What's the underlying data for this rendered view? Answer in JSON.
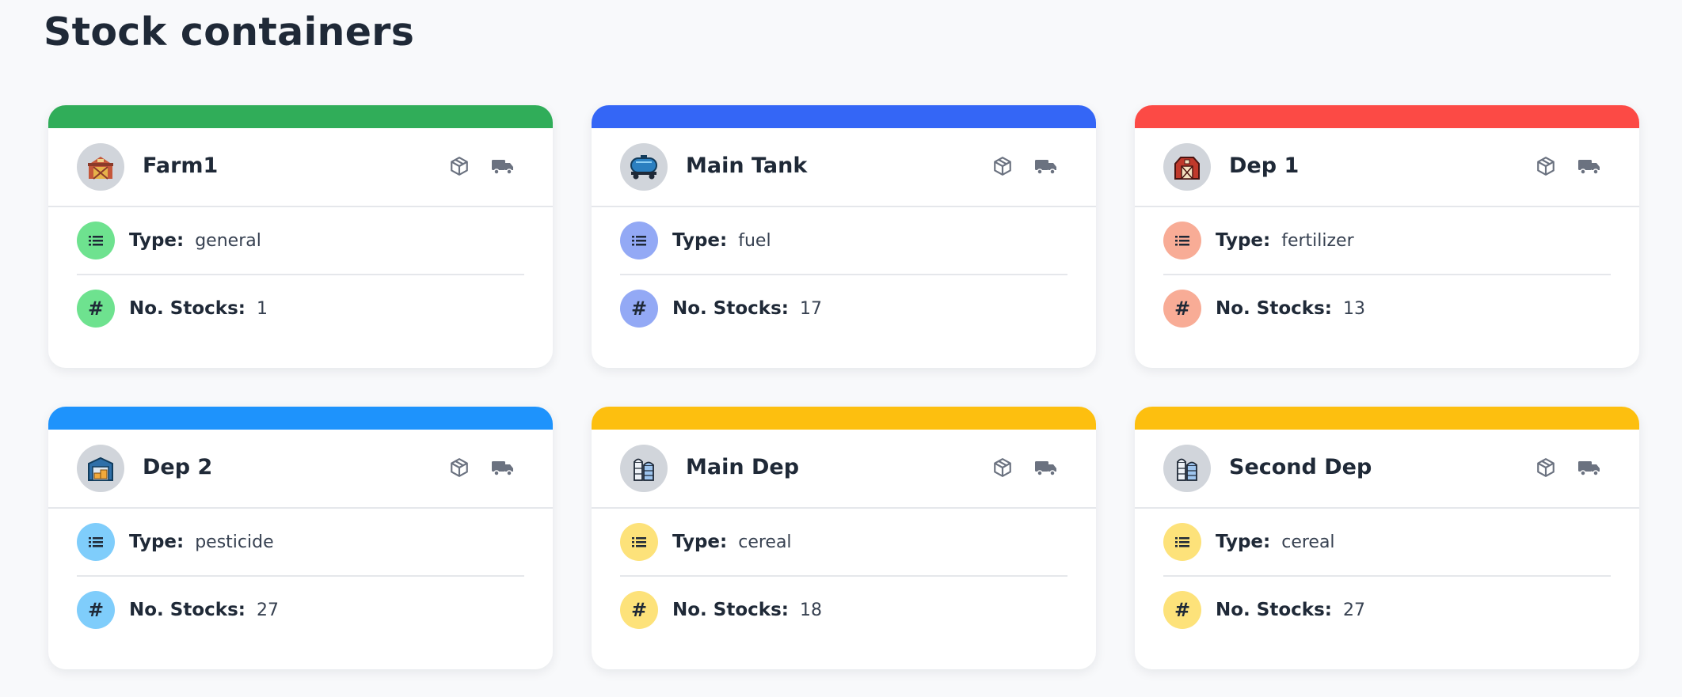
{
  "page": {
    "title": "Stock containers"
  },
  "labels": {
    "type": "Type:",
    "stocks": "No. Stocks:"
  },
  "icons": {
    "action_box": "box-icon",
    "action_truck": "truck-icon",
    "type_row": "list-icon",
    "stocks_row": "hash-icon"
  },
  "cards": [
    {
      "name": "Farm1",
      "avatar_icon": "warehouse-icon",
      "type": "general",
      "stocks": "1",
      "accent": "#30ad59",
      "soft": "#6ee28f"
    },
    {
      "name": "Main Tank",
      "avatar_icon": "fuel-tank-icon",
      "type": "fuel",
      "stocks": "17",
      "accent": "#3466f6",
      "soft": "#93a9f5"
    },
    {
      "name": "Dep 1",
      "avatar_icon": "barn-icon",
      "type": "fertilizer",
      "stocks": "13",
      "accent": "#fc4a45",
      "soft": "#f8ac96"
    },
    {
      "name": "Dep 2",
      "avatar_icon": "depot-icon",
      "type": "pesticide",
      "stocks": "27",
      "accent": "#1e93fc",
      "soft": "#7fcdfb"
    },
    {
      "name": "Main Dep",
      "avatar_icon": "silo-icon",
      "type": "cereal",
      "stocks": "18",
      "accent": "#fdbf0f",
      "soft": "#fde27a"
    },
    {
      "name": "Second Dep",
      "avatar_icon": "silo-icon",
      "type": "cereal",
      "stocks": "27",
      "accent": "#fdbf0f",
      "soft": "#fde27a"
    }
  ]
}
